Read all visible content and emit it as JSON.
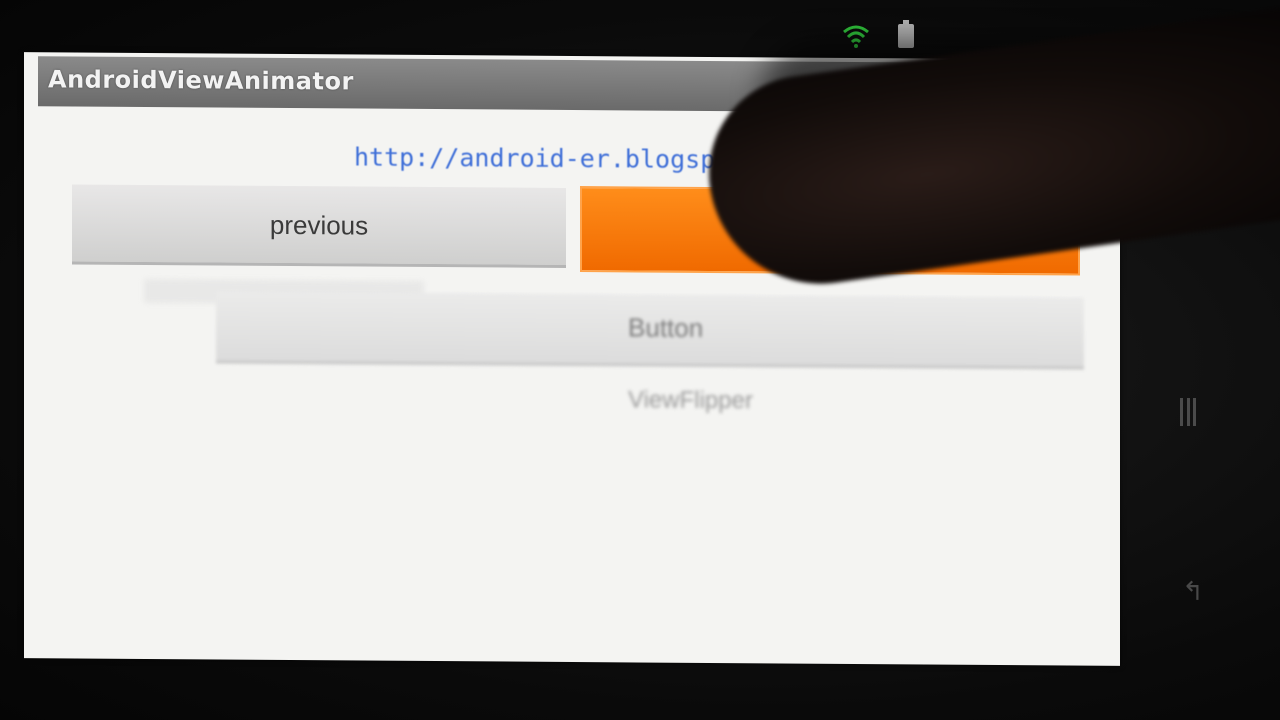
{
  "app": {
    "title": "AndroidViewAnimator"
  },
  "content": {
    "link_text": "http://android-er.blogspo"
  },
  "buttons": {
    "previous_label": "previous"
  },
  "animated_view": {
    "label": "Button",
    "caption": "ViewFlipper"
  },
  "status_bar": {
    "icons": [
      "wifi-icon",
      "battery-icon"
    ]
  },
  "hardware_keys": {
    "icons": [
      "menu-key-icon",
      "back-key-icon"
    ],
    "back_glyph": "↰"
  },
  "colors": {
    "title_bar": "#6f6f6f",
    "next_button": "#f47a0a",
    "link": "#3f6fd8",
    "screen_background": "#f4f4f2"
  }
}
